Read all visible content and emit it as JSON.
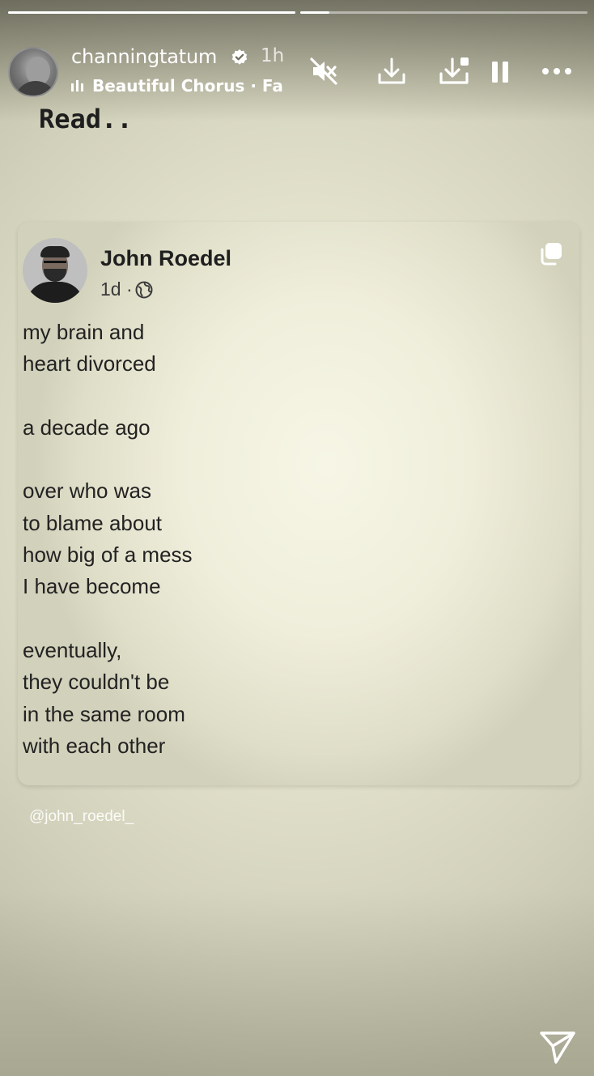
{
  "story": {
    "progress": [
      {
        "fill": 1.0
      },
      {
        "fill": 0.1
      }
    ],
    "user": {
      "username": "channingtatum",
      "verified": true,
      "time_ago": "1h"
    },
    "music": {
      "label": "Beautiful Chorus · Fa"
    },
    "controls": {
      "mute_icon": "speaker-muted-icon",
      "download_icon": "download-icon",
      "save_icon": "save-to-collection-icon",
      "pause_icon": "pause-icon",
      "more_icon": "more-icon"
    },
    "caption": "Read..",
    "handle": "@john_roedel_",
    "send_icon": "send-icon"
  },
  "post": {
    "author": "John Roedel",
    "meta": "1d ·",
    "lines": [
      "my brain and",
      "heart divorced",
      "",
      "a decade ago",
      "",
      "over who was",
      "to blame about",
      "how big of a mess",
      "I have become",
      "",
      "eventually,",
      "they couldn't be",
      "in the same room",
      "with each other"
    ]
  },
  "colors": {
    "background": "#e2e1cb",
    "card": "#efeedb",
    "text": "#222222",
    "header_text": "#ffffff"
  }
}
